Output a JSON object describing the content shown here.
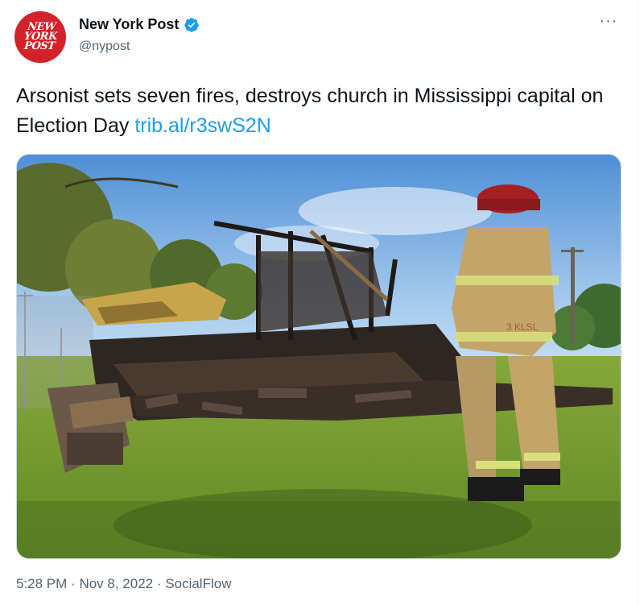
{
  "tweet": {
    "author_name": "New York Post",
    "handle": "@nypost",
    "avatar_logo": [
      "NEW",
      "YORK",
      "POST"
    ],
    "text": "Arsonist sets seven fires, destroys church in Mississippi capital on Election Day",
    "link": "trib.al/r3swS2N",
    "time": "5:28 PM",
    "date": "Nov 8, 2022",
    "source": "SocialFlow",
    "separator": "·",
    "more_label": "···"
  },
  "image": {
    "helmet_text": "3 KLSL"
  },
  "colors": {
    "accent": "#1d9bf0",
    "brand": "#d4212a",
    "text": "#0f1419",
    "muted": "#536471"
  },
  "icons": [
    "verified-badge-icon",
    "more-options-icon"
  ]
}
